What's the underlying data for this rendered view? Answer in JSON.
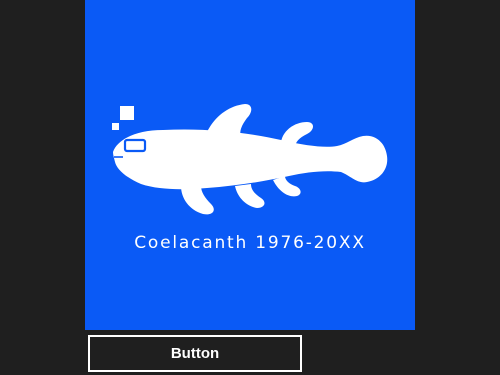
{
  "tile": {
    "caption": "Coelacanth 1976-20XX",
    "icon": "coelacanth-fish-icon",
    "background_color": "#0a5af6"
  },
  "button": {
    "label": "Button"
  },
  "colors": {
    "page_background": "#1f1f1f",
    "foreground": "#ffffff"
  }
}
